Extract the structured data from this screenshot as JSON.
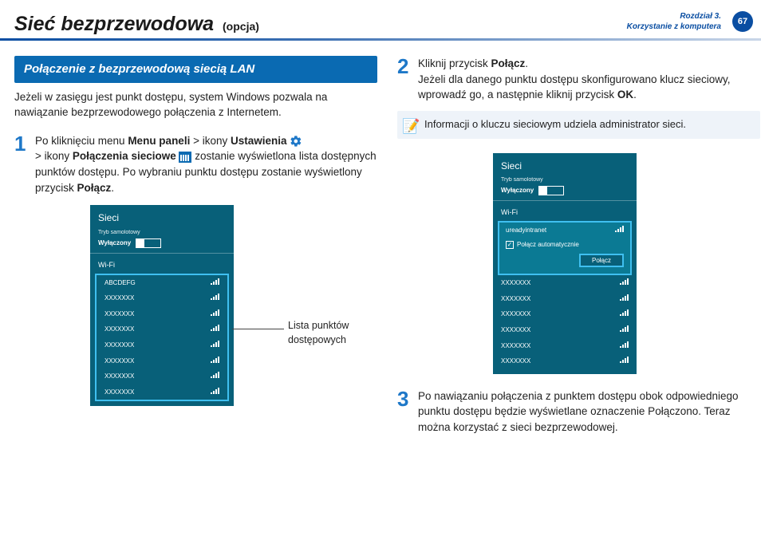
{
  "header": {
    "title": "Sieć bezprzewodowa",
    "option": "(opcja)",
    "chapter_line1": "Rozdział 3.",
    "chapter_line2": "Korzystanie z komputera",
    "page_number": "67"
  },
  "left": {
    "section_heading": "Połączenie z bezprzewodową siecią LAN",
    "intro": "Jeżeli w zasięgu jest punkt dostępu, system Windows pozwala na nawiązanie bezprzewodowego połączenia z Internetem.",
    "step1_num": "1",
    "step1_a": "Po kliknięciu menu ",
    "step1_b": "Menu paneli",
    "step1_c": " > ikony ",
    "step1_d": "Ustawienia",
    "step1_e": " > ikony ",
    "step1_f": "Połączenia sieciowe",
    "step1_g": " zostanie wyświetlona lista dostępnych punktów dostępu. Po wybraniu punktu dostępu zostanie wyświetlony przycisk ",
    "step1_h": "Połącz",
    "step1_i": ".",
    "callout": "Lista punktów dostępowych"
  },
  "right": {
    "step2_num": "2",
    "step2_a": "Kliknij przycisk ",
    "step2_b": "Połącz",
    "step2_c": ".",
    "step2_d": "Jeżeli dla danego punktu dostępu skonfigurowano klucz sieciowy, wprowadź go, a następnie kliknij przycisk ",
    "step2_e": "OK",
    "step2_f": ".",
    "note": "Informacji o kluczu sieciowym udziela administrator sieci.",
    "step3_num": "3",
    "step3_body": "Po nawiązaniu połączenia z punktem dostępu obok odpowiedniego punktu dostępu będzie wyświetlane oznaczenie Połączono. Teraz można korzystać z sieci bezprzewodowej."
  },
  "panel": {
    "networks": "Sieci",
    "airplane_label": "Tryb samolotowy",
    "airplane_state": "Wyłączony",
    "wifi_label": "Wi-Fi",
    "ap_first": "ABCDEFG",
    "ap_generic": "XXXXXXX",
    "selected_ap": "ureadyintranet",
    "autoconnect": "Połącz automatycznie",
    "connect_btn": "Połącz",
    "check": "✓"
  }
}
